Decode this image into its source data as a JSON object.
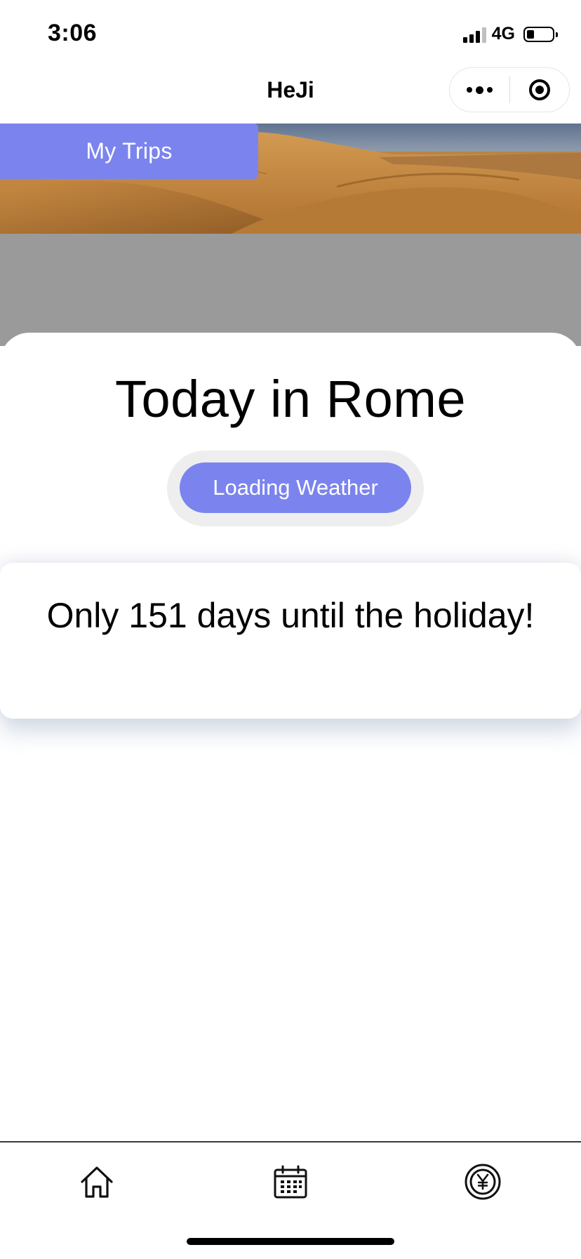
{
  "status_bar": {
    "time": "3:06",
    "network": "4G",
    "battery_level": 0.3
  },
  "nav": {
    "title": "HeJi",
    "more_icon": "more-dots-icon",
    "close_icon": "target-icon"
  },
  "banner": {
    "image": "desert-dunes",
    "my_trips_label": "My Trips"
  },
  "today": {
    "title": "Today in Rome",
    "weather_button_label": "Loading Weather"
  },
  "countdown": {
    "text": "Only 151 days until the holiday!"
  },
  "tab_bar": {
    "items": [
      {
        "icon": "home-icon"
      },
      {
        "icon": "calendar-icon"
      },
      {
        "icon": "yen-coin-icon"
      }
    ]
  },
  "colors": {
    "accent": "#7b84ee",
    "grey_band": "#9a9a9a"
  }
}
